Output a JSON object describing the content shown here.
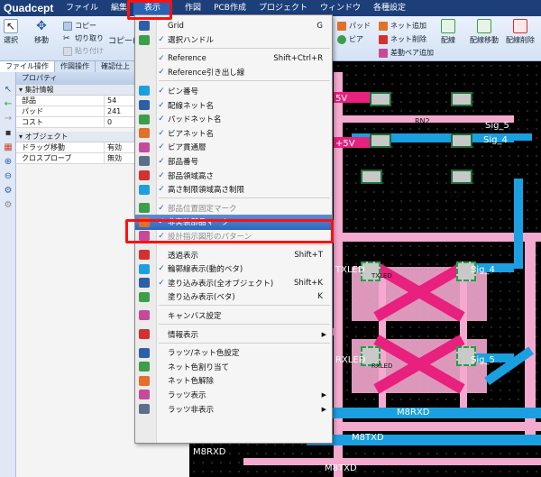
{
  "app": {
    "logo": "Quadcept"
  },
  "menubar": [
    {
      "label": "ファイル"
    },
    {
      "label": "編集"
    },
    {
      "label": "表示",
      "active": true
    },
    {
      "label": "作図"
    },
    {
      "label": "PCB作成"
    },
    {
      "label": "プロジェクト"
    },
    {
      "label": "ウィンドウ"
    },
    {
      "label": "各種設定"
    }
  ],
  "ribbon": {
    "select": "選択",
    "move": "移動",
    "copy": "コピー",
    "cut": "切り取り",
    "paste": "貼り付け",
    "copy2": "コピー(",
    "pad": "パッド",
    "via": "ビア",
    "net_add": "ネット追加",
    "net_delete": "ネット削除",
    "diff_pair_add": "差動ペア追加",
    "route": "配線",
    "route_move": "配線移動",
    "route_delete": "配線削除"
  },
  "tabs": [
    "ファイル操作",
    "作図操作",
    "確認仕上"
  ],
  "properties": {
    "title": "プロパティ",
    "sections": [
      {
        "name": "集計情報",
        "rows": [
          {
            "key": "部品",
            "value": "54"
          },
          {
            "key": "パッド",
            "value": "241"
          },
          {
            "key": "コスト",
            "value": "0"
          }
        ]
      },
      {
        "name": "オブジェクト",
        "rows": [
          {
            "key": "ドラッグ移動",
            "value": "有効"
          },
          {
            "key": "クロスプローブ",
            "value": "無効"
          }
        ]
      }
    ]
  },
  "view_menu": {
    "items": [
      {
        "label": "Grid",
        "shortcut": "G",
        "icon": "grid-icon",
        "checked": false
      },
      {
        "label": "選択ハンドル",
        "icon": "handle-icon",
        "checked": true
      },
      {
        "sep": true
      },
      {
        "label": "Reference",
        "shortcut": "Shift+Ctrl+R",
        "checked": true
      },
      {
        "label": "Reference引き出し線",
        "checked": true
      },
      {
        "sep": true
      },
      {
        "label": "ピン番号",
        "icon": "pin-number-icon",
        "checked": true
      },
      {
        "label": "配線ネット名",
        "icon": "route-net-icon",
        "checked": true
      },
      {
        "label": "パッドネット名",
        "icon": "pad-net-icon",
        "checked": true
      },
      {
        "label": "ビアネット名",
        "icon": "via-net-icon",
        "checked": true
      },
      {
        "label": "ビア貫通層",
        "icon": "via-layer-icon",
        "checked": true
      },
      {
        "label": "部品番号",
        "icon": "part-number-icon",
        "checked": true
      },
      {
        "label": "部品領域高さ",
        "icon": "part-height-icon",
        "checked": true
      },
      {
        "label": "高さ制限領域高さ制限",
        "icon": "height-limit-icon",
        "checked": true
      },
      {
        "sep": true
      },
      {
        "label": "部品位置固定マーク",
        "icon": "lock-mark-icon",
        "checked": true,
        "disabled": true
      },
      {
        "label": "非実装部品マーク",
        "icon": "unmounted-mark-icon",
        "checked": true,
        "selected": true
      },
      {
        "label": "設計指示図形のパターン",
        "icon": "pattern-icon",
        "checked": true,
        "disabled": true
      },
      {
        "sep": true
      },
      {
        "label": "透過表示",
        "shortcut": "Shift+T",
        "icon": "transparent-icon",
        "checked": false
      },
      {
        "label": "輪郭線表示(動的ベタ)",
        "icon": "outline-icon",
        "checked": true
      },
      {
        "label": "塗り込み表示(全オブジェクト)",
        "shortcut": "Shift+K",
        "icon": "fill-all-icon",
        "checked": true
      },
      {
        "label": "塗り込み表示(ベタ)",
        "shortcut": "K",
        "icon": "fill-beta-icon",
        "checked": false
      },
      {
        "sep": true
      },
      {
        "label": "キャンバス設定",
        "icon": "canvas-icon",
        "checked": false
      },
      {
        "sep": true
      },
      {
        "label": "情報表示",
        "icon": "info-icon",
        "checked": false,
        "submenu": true
      },
      {
        "sep": true
      },
      {
        "label": "ラッツ/ネット色設定",
        "icon": "rats-color-icon",
        "checked": false
      },
      {
        "label": "ネット色割り当て",
        "icon": "net-color-icon",
        "checked": false
      },
      {
        "label": "ネット色解除",
        "icon": "net-color-clear-icon",
        "checked": false
      },
      {
        "label": "ラッツ表示",
        "icon": "rats-show-icon",
        "checked": false,
        "submenu": true
      },
      {
        "label": "ラッツ非表示",
        "icon": "rats-hide-icon",
        "checked": false,
        "submenu": true
      }
    ]
  },
  "pcb": {
    "labels": [
      {
        "text": "5V"
      },
      {
        "text": "+5V"
      },
      {
        "text": "RN2"
      },
      {
        "text": "Sig_5"
      },
      {
        "text": "Sig_4"
      },
      {
        "text": "TXLED"
      },
      {
        "text": "TXLED"
      },
      {
        "text": "Sig_4"
      },
      {
        "text": "RXLED"
      },
      {
        "text": "RXLED"
      },
      {
        "text": "Sig_5"
      },
      {
        "text": "M8RXD"
      },
      {
        "text": "M8TXD"
      },
      {
        "text": "M8RXD"
      },
      {
        "text": "M8TXD"
      },
      {
        "text": "1 2"
      }
    ]
  },
  "colors": {
    "accent": "#1c3f7a",
    "highlight": "#ff1010",
    "trace_pink": "#f4a9cf",
    "trace_cyan": "#1aa0e0"
  }
}
